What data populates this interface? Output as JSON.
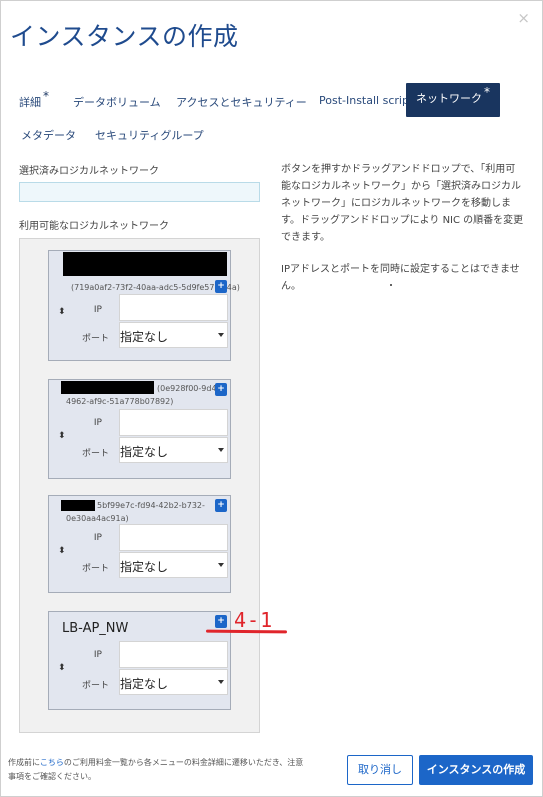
{
  "dialog": {
    "title": "インスタンスの作成",
    "close_glyph": "×"
  },
  "tabs": [
    {
      "label": "詳細",
      "star": "*"
    },
    {
      "label": "データボリューム",
      "star": ""
    },
    {
      "label": "アクセスとセキュリティー",
      "star": ""
    },
    {
      "label": "Post-Install script",
      "star": ""
    },
    {
      "label": "ネットワーク",
      "star": "*",
      "active": true
    },
    {
      "label": "メタデータ",
      "star": ""
    },
    {
      "label": "セキュリティグループ",
      "star": ""
    }
  ],
  "selected_networks": {
    "label": "選択済みロジカルネットワーク"
  },
  "available_networks": {
    "label": "利用可能なロジカルネットワーク",
    "cards": [
      {
        "id_line1": "(719a0af2-73f2-40aa-adc5-5d9fe57c5f4a)",
        "id_line2": "",
        "ip_label": "IP",
        "port_label": "ポート",
        "port_value": "指定なし",
        "add_glyph": "+"
      },
      {
        "id_line1": "(0e928f00-9d45-",
        "id_line2": "4962-af9c-51a778b07892)",
        "ip_label": "IP",
        "port_label": "ポート",
        "port_value": "指定なし",
        "add_glyph": "+"
      },
      {
        "id_line1": "5bf99e7c-fd94-42b2-b732-",
        "id_line2": "0e30aa4ac91a)",
        "ip_label": "IP",
        "port_label": "ポート",
        "port_value": "指定なし",
        "add_glyph": "+"
      },
      {
        "name": "LB-AP_NW",
        "ip_label": "IP",
        "port_label": "ポート",
        "port_value": "指定なし",
        "add_glyph": "+"
      }
    ]
  },
  "help": {
    "paragraph1": "ボタンを押すかドラッグアンドドロップで、「利用可能なロジカルネットワーク」から「選択済みロジカルネットワーク」にロジカルネットワークを移動します。ドラッグアンドドロップにより NIC の順番を変更できます。",
    "paragraph2": "IPアドレスとポートを同時に設定することはできません。"
  },
  "annotation": {
    "text": "4-1",
    "color": "#e0252b"
  },
  "footer": {
    "note_prefix": "作成前に",
    "note_link": "こちら",
    "note_suffix": "のご利用料金一覧から各メニューの料金詳細に遷移いただき、注意事項をご確認ください。",
    "cancel_label": "取り消し",
    "create_label": "インスタンスの作成"
  },
  "colors": {
    "accent": "#1c66c8",
    "active_tab": "#19355f",
    "title": "#1f4b8e"
  },
  "icons": {
    "close": "close-icon",
    "sort": "sort-arrows-icon",
    "caret": "chevron-down-icon",
    "add": "plus-icon"
  }
}
